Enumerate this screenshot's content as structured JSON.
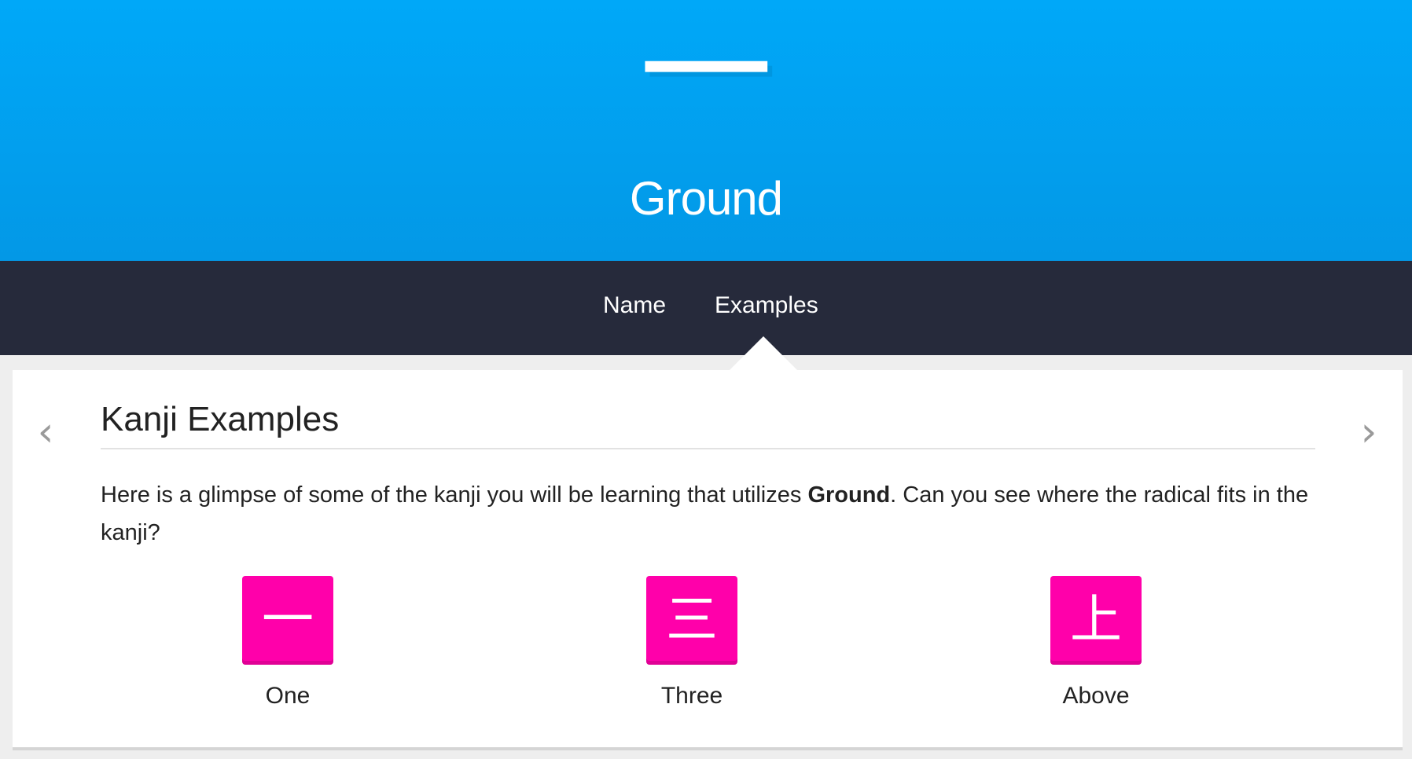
{
  "header": {
    "radical_character": "一",
    "radical_name": "Ground"
  },
  "nav": {
    "tabs": [
      {
        "label": "Name",
        "active": false
      },
      {
        "label": "Examples",
        "active": true
      }
    ]
  },
  "section": {
    "title": "Kanji Examples",
    "description_before": "Here is a glimpse of some of the kanji you will be learning that utilizes ",
    "description_emphasis": "Ground",
    "description_after": ". Can you see where the radical fits in the kanji?"
  },
  "controls": {
    "prev_icon": "‹",
    "next_icon": "›"
  },
  "kanji": [
    {
      "character": "一",
      "meaning": "One"
    },
    {
      "character": "三",
      "meaning": "Three"
    },
    {
      "character": "上",
      "meaning": "Above"
    }
  ],
  "colors": {
    "radical_blue": "#00a8f8",
    "navbar": "#262a3b",
    "kanji_pink": "#ff00aa"
  }
}
